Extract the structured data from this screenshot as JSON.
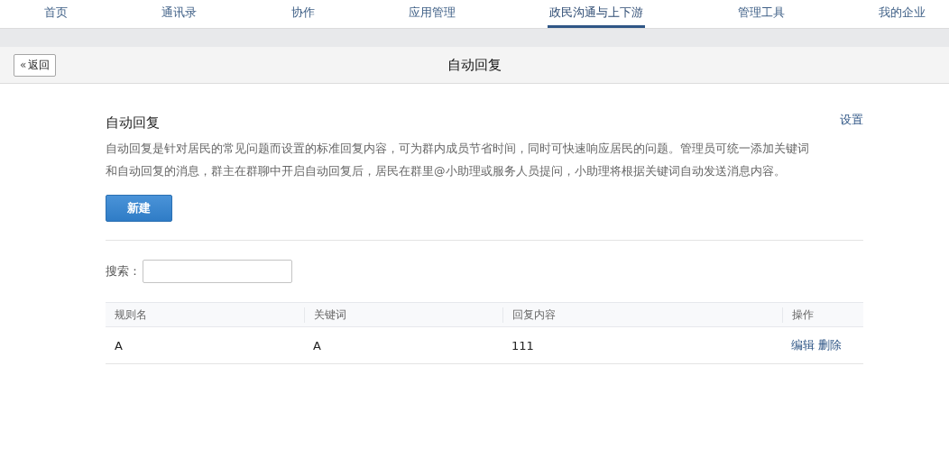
{
  "nav": [
    {
      "label": "首页",
      "selected": false
    },
    {
      "label": "通讯录",
      "selected": false
    },
    {
      "label": "协作",
      "selected": false
    },
    {
      "label": "应用管理",
      "selected": false
    },
    {
      "label": "政民沟通与上下游",
      "selected": true
    },
    {
      "label": "管理工具",
      "selected": false
    },
    {
      "label": "我的企业",
      "selected": false
    }
  ],
  "back_button": {
    "icon": "«",
    "label": "返回"
  },
  "page_title": "自动回复",
  "section": {
    "title": "自动回复",
    "settings_link": "设置",
    "description": "自动回复是针对居民的常见问题而设置的标准回复内容，可为群内成员节省时间，同时可快速响应居民的问题。管理员可统一添加关键词和自动回复的消息，群主在群聊中开启自动回复后，居民在群里@小助理或服务人员提问，小助理将根据关键词自动发送消息内容。",
    "new_button": "新建"
  },
  "search": {
    "label": "搜索："
  },
  "table": {
    "columns": [
      "规则名",
      "关键词",
      "回复内容",
      "操作"
    ],
    "rows": [
      {
        "cells": [
          "A",
          "A",
          "111"
        ],
        "actions": [
          "编辑",
          "删除"
        ]
      }
    ]
  }
}
